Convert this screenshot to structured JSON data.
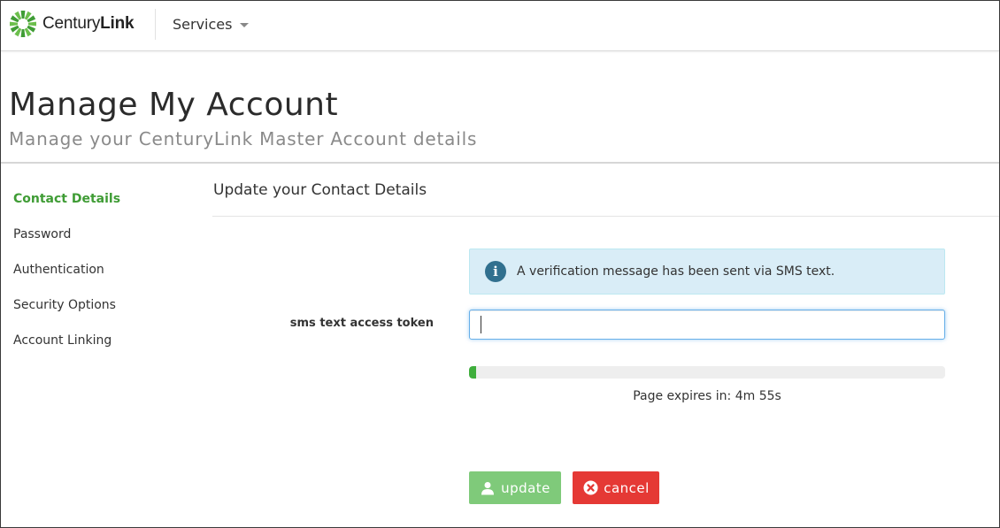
{
  "brand": {
    "name_light": "Century",
    "name_bold": "Link",
    "logo_icon": "centurylink-starburst-icon",
    "accent_color": "#3f9c35"
  },
  "nav": {
    "services_label": "Services"
  },
  "header": {
    "title": "Manage My Account",
    "subtitle": "Manage your CenturyLink Master Account details"
  },
  "sidebar": {
    "items": [
      {
        "label": "Contact Details",
        "active": true
      },
      {
        "label": "Password",
        "active": false
      },
      {
        "label": "Authentication",
        "active": false
      },
      {
        "label": "Security Options",
        "active": false
      },
      {
        "label": "Account Linking",
        "active": false
      }
    ]
  },
  "main": {
    "section_title": "Update your Contact Details",
    "alert": {
      "icon": "info-icon",
      "text": "A verification message has been sent via SMS text.",
      "color": "#d9edf7"
    },
    "token_field": {
      "label": "sms text access token",
      "value": "",
      "placeholder": ""
    },
    "progress": {
      "fraction": 0.015,
      "color": "#3fae3c"
    },
    "expires_text": "Page expires in: 4m 55s",
    "buttons": {
      "update": {
        "label": "update",
        "icon": "user-icon",
        "color": "#7fca7a"
      },
      "cancel": {
        "label": "cancel",
        "icon": "close-circle-icon",
        "color": "#e53935"
      }
    }
  }
}
